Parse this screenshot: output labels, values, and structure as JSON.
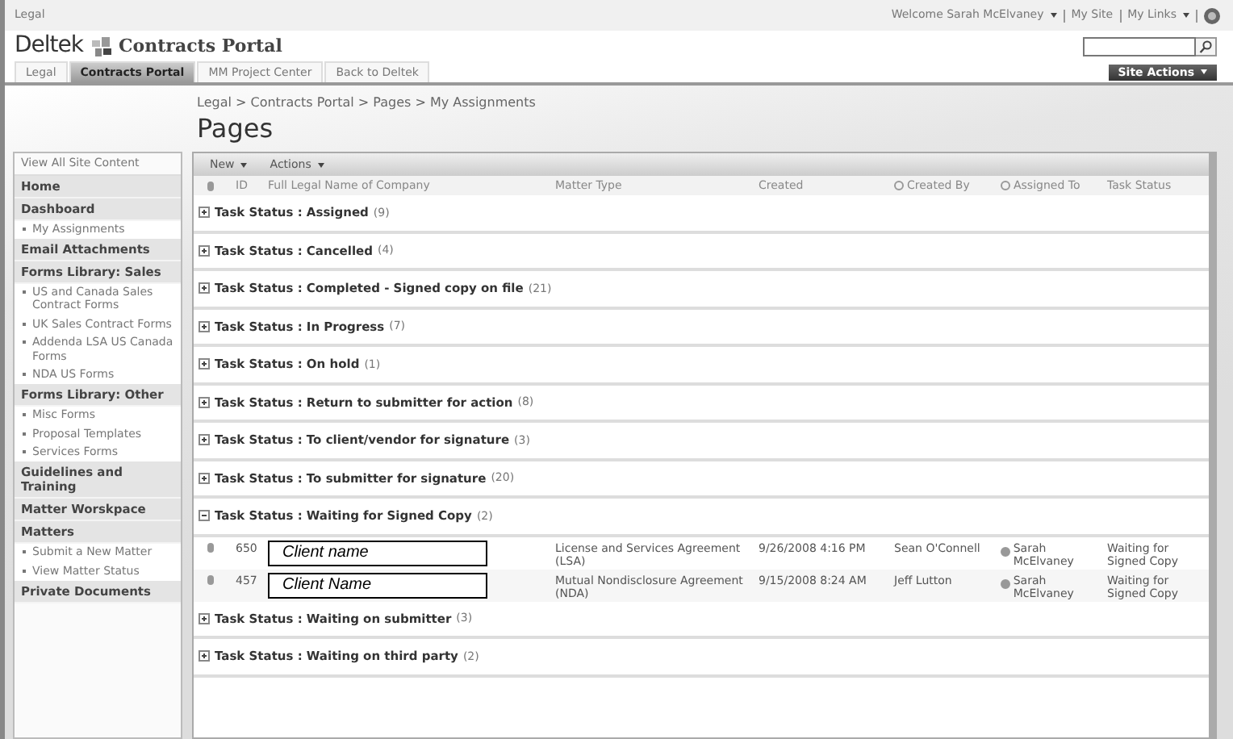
{
  "top_bar": {
    "site": "Legal",
    "welcome": "Welcome Sarah McElvaney",
    "links": [
      {
        "label": "My Site",
        "dropdown": false
      },
      {
        "label": "My Links",
        "dropdown": true
      }
    ]
  },
  "header": {
    "brand": "Deltek",
    "portal": "Contracts Portal"
  },
  "tabs": [
    {
      "label": "Legal",
      "selected": false
    },
    {
      "label": "Contracts Portal",
      "selected": true
    },
    {
      "label": "MM Project Center",
      "selected": false
    },
    {
      "label": "Back to Deltek",
      "selected": false
    }
  ],
  "site_actions": "Site Actions",
  "breadcrumb": "Legal > Contracts Portal > Pages > My Assignments",
  "page_title": "Pages",
  "sidebar": {
    "items": [
      {
        "kind": "link",
        "label": "View All Site Content"
      },
      {
        "kind": "heading",
        "label": "Home"
      },
      {
        "kind": "heading",
        "label": "Dashboard"
      },
      {
        "kind": "item",
        "label": "My Assignments"
      },
      {
        "kind": "heading",
        "label": "Email Attachments"
      },
      {
        "kind": "heading",
        "label": "Forms Library: Sales"
      },
      {
        "kind": "item",
        "label": "US and Canada Sales Contract Forms"
      },
      {
        "kind": "item",
        "label": "UK Sales Contract Forms"
      },
      {
        "kind": "item",
        "label": "Addenda LSA US Canada Forms"
      },
      {
        "kind": "item",
        "label": "NDA US Forms"
      },
      {
        "kind": "heading",
        "label": "Forms Library: Other"
      },
      {
        "kind": "item",
        "label": "Misc Forms"
      },
      {
        "kind": "item",
        "label": "Proposal Templates"
      },
      {
        "kind": "item",
        "label": "Services Forms"
      },
      {
        "kind": "heading",
        "label": "Guidelines and Training"
      },
      {
        "kind": "heading",
        "label": "Matter Worskpace"
      },
      {
        "kind": "heading",
        "label": "Matters"
      },
      {
        "kind": "item",
        "label": "Submit a New Matter"
      },
      {
        "kind": "item",
        "label": "View Matter Status"
      },
      {
        "kind": "heading",
        "label": "Private Documents"
      }
    ]
  },
  "toolbar": [
    "New",
    "Actions"
  ],
  "table": {
    "columns": [
      {
        "label": "ID",
        "presence": false
      },
      {
        "label": "Full Legal Name of Company",
        "presence": false
      },
      {
        "label": "Matter Type",
        "presence": false
      },
      {
        "label": "Created",
        "presence": false
      },
      {
        "label": "Created By",
        "presence": true
      },
      {
        "label": "Assigned To",
        "presence": true
      },
      {
        "label": "Task Status",
        "presence": false
      }
    ],
    "groups": [
      {
        "label": "Task Status : Assigned",
        "count": "(9)",
        "expanded": false
      },
      {
        "label": "Task Status : Cancelled",
        "count": "(4)",
        "expanded": false
      },
      {
        "label": "Task Status : Completed - Signed copy on file",
        "count": "(21)",
        "expanded": false
      },
      {
        "label": "Task Status : In Progress",
        "count": "(7)",
        "expanded": false
      },
      {
        "label": "Task Status : On hold",
        "count": "(1)",
        "expanded": false
      },
      {
        "label": "Task Status : Return to submitter for action",
        "count": "(8)",
        "expanded": false
      },
      {
        "label": "Task Status : To client/vendor for signature",
        "count": "(3)",
        "expanded": false
      },
      {
        "label": "Task Status : To submitter for signature",
        "count": "(20)",
        "expanded": false
      },
      {
        "label": "Task Status : Waiting for Signed Copy",
        "count": "(2)",
        "expanded": true,
        "rows": [
          {
            "id": "650",
            "company": "Client name",
            "matter_type": "License and Services Agreement (LSA)",
            "created": "9/26/2008 4:16 PM",
            "created_by": "Sean O'Connell",
            "assigned_to": "Sarah McElvaney",
            "task_status": "Waiting for Signed Copy"
          },
          {
            "id": "457",
            "company": "Client Name",
            "matter_type": "Mutual Nondisclosure Agreement (NDA)",
            "created": "9/15/2008 8:24 AM",
            "created_by": "Jeff Lutton",
            "assigned_to": "Sarah McElvaney",
            "task_status": "Waiting for Signed Copy"
          }
        ]
      },
      {
        "label": "Task Status : Waiting on submitter",
        "count": "(3)",
        "expanded": false
      },
      {
        "label": "Task Status : Waiting on third party",
        "count": "(2)",
        "expanded": false
      }
    ]
  }
}
